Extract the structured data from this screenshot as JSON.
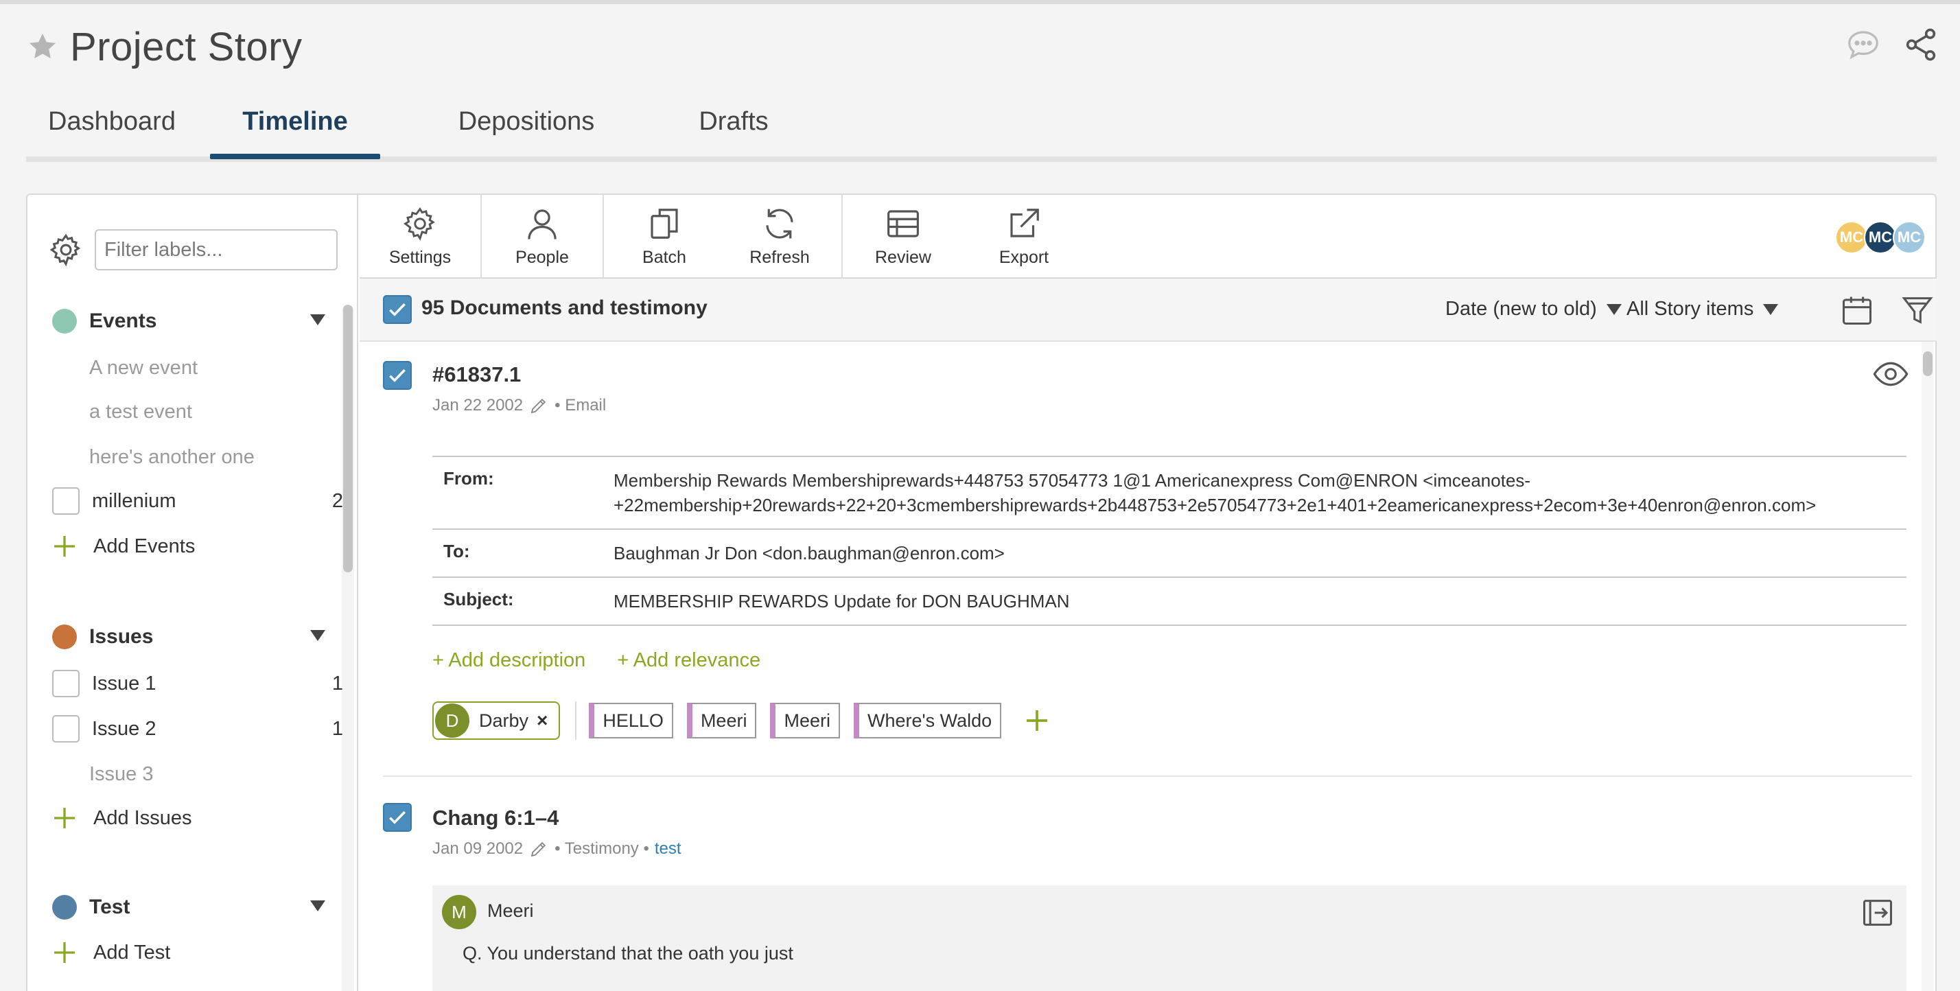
{
  "header": {
    "title": "Project Story"
  },
  "tabs": [
    {
      "label": "Dashboard"
    },
    {
      "label": "Timeline"
    },
    {
      "label": "Depositions"
    },
    {
      "label": "Drafts"
    }
  ],
  "sidebar": {
    "filter_placeholder": "Filter labels...",
    "events": {
      "title": "Events",
      "color": "#8fc8b0",
      "items": [
        "A new event",
        "a test event",
        "here's another one"
      ],
      "check_items": [
        {
          "label": "millenium",
          "count": "2"
        }
      ],
      "add_label": "Add Events"
    },
    "issues": {
      "title": "Issues",
      "color": "#c8733a",
      "check_items": [
        {
          "label": "Issue 1",
          "count": "1"
        },
        {
          "label": "Issue 2",
          "count": "1"
        }
      ],
      "muted_item": "Issue 3",
      "add_label": "Add Issues"
    },
    "test": {
      "title": "Test",
      "color": "#5580a6",
      "add_label": "Add Test"
    }
  },
  "toolbar": {
    "settings": "Settings",
    "people": "People",
    "batch": "Batch",
    "refresh": "Refresh",
    "review": "Review",
    "export": "Export",
    "avatars": [
      {
        "initials": "MC",
        "color": "#f3c867"
      },
      {
        "initials": "MC",
        "color": "#1e4264"
      },
      {
        "initials": "MC",
        "color": "#9fc7e0"
      }
    ]
  },
  "list": {
    "title": "95 Documents and testimony",
    "sort": "Date (new to old)",
    "filter": "All Story items"
  },
  "items": [
    {
      "title": "#61837.1",
      "date": "Jan 22 2002",
      "type": "• Email",
      "email": {
        "from_label": "From:",
        "from_line1": "Membership Rewards Membershiprewards+448753 57054773 1@1 Americanexpress Com@ENRON <imceanotes-",
        "from_line2": "+22membership+20rewards+22+20+3cmembershiprewards+2b448753+2e57054773+2e1+401+2eamericanexpress+2ecom+3e+40enron@enron.com>",
        "to_label": "To:",
        "to": "Baughman Jr Don <don.baughman@enron.com>",
        "subject_label": "Subject:",
        "subject": "MEMBERSHIP REWARDS Update for DON BAUGHMAN"
      },
      "add_description": "+ Add description",
      "add_relevance": "+ Add relevance",
      "person_tag": {
        "initial": "D",
        "name": "Darby",
        "remove": "×"
      },
      "labels": [
        "HELLO",
        "Meeri",
        "Meeri",
        "Where's Waldo"
      ]
    },
    {
      "title": "Chang 6:1–4",
      "date": "Jan 09 2002",
      "type": "• Testimony •",
      "link": "test",
      "speaker_initial": "M",
      "speaker": "Meeri",
      "text": "Q.   You understand that the oath you just"
    }
  ]
}
